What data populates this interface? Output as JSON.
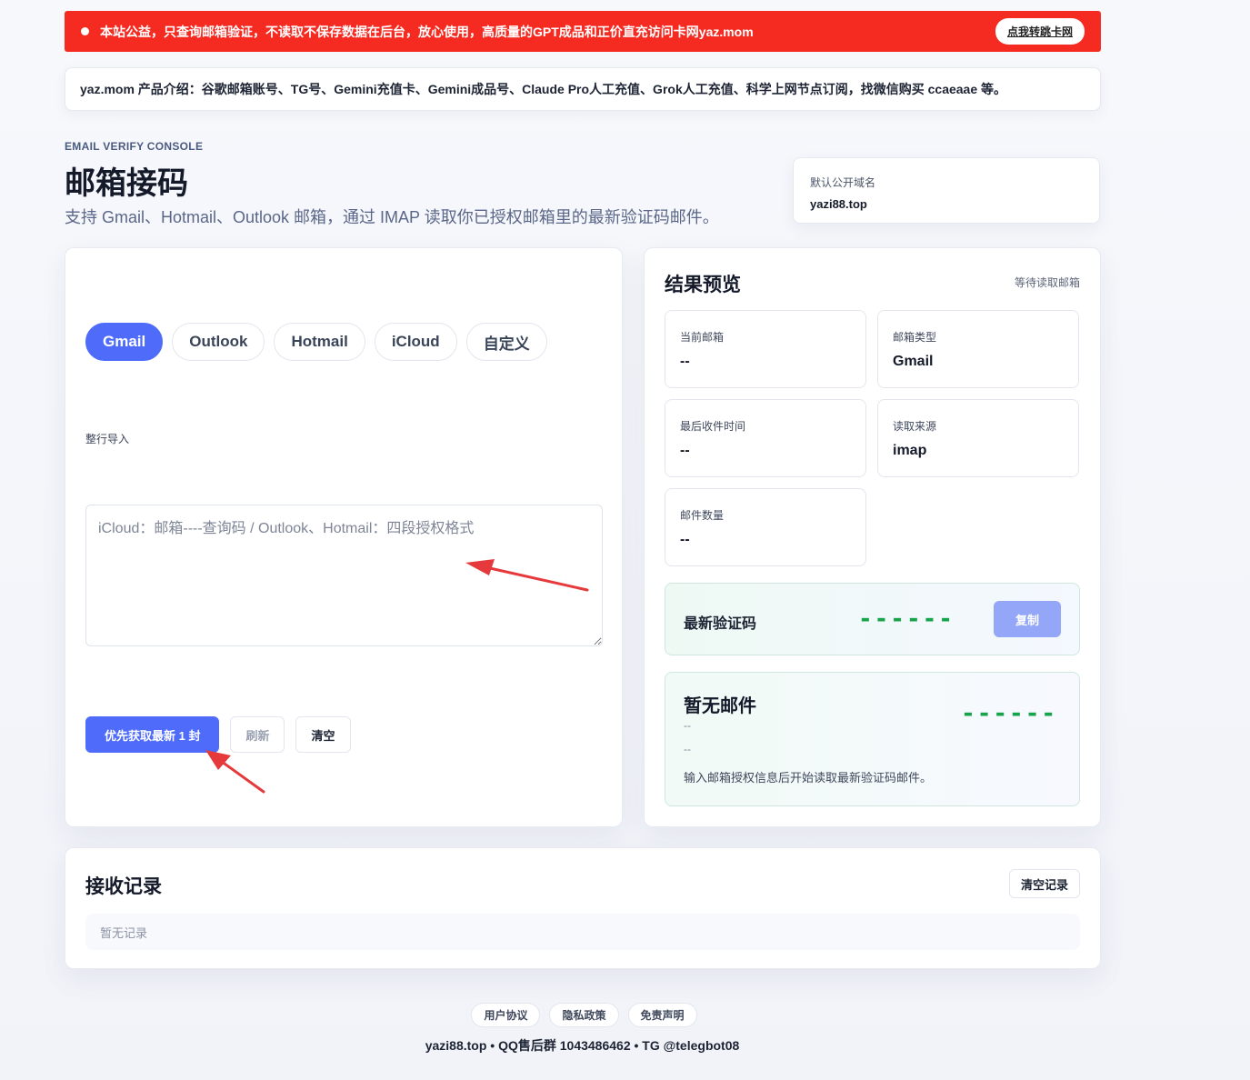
{
  "notice": {
    "text": "本站公益，只查询邮箱验证，不读取不保存数据在后台，放心使用，高质量的GPT成品和正价直充访问卡网yaz.mom",
    "jump_label": "点我转跳卡网"
  },
  "intro": {
    "text": "yaz.mom 产品介绍：谷歌邮箱账号、TG号、Gemini充值卡、Gemini成品号、Claude Pro人工充值、Grok人工充值、科学上网节点订阅，找微信购买 ccaeaae 等。"
  },
  "hero": {
    "eyebrow": "EMAIL VERIFY CONSOLE",
    "title": "邮箱接码",
    "subtitle": "支持 Gmail、Hotmail、Outlook 邮箱，通过 IMAP 读取你已授权邮箱里的最新验证码邮件。"
  },
  "domain": {
    "label": "默认公开域名",
    "value": "yazi88.top"
  },
  "tabs": [
    "Gmail",
    "Outlook",
    "Hotmail",
    "iCloud",
    "自定义"
  ],
  "form": {
    "import_label": "整行导入",
    "placeholder": "iCloud：邮箱----查询码 / Outlook、Hotmail：四段授权格式",
    "fetch_label": "优先获取最新 1 封",
    "refresh_label": "刷新",
    "clear_label": "清空"
  },
  "preview": {
    "title": "结果预览",
    "status": "等待读取邮箱",
    "stats": [
      {
        "label": "当前邮箱",
        "value": "--"
      },
      {
        "label": "邮箱类型",
        "value": "Gmail"
      },
      {
        "label": "最后收件时间",
        "value": "--"
      },
      {
        "label": "读取来源",
        "value": "imap"
      },
      {
        "label": "邮件数量",
        "value": "--"
      }
    ],
    "code_label": "最新验证码",
    "code_value": "------",
    "copy_label": "复制",
    "mail_title": "暂无邮件",
    "mail_from": "--",
    "mail_time": "--",
    "mail_code": "------",
    "mail_message": "输入邮箱授权信息后开始读取最新验证码邮件。"
  },
  "records": {
    "title": "接收记录",
    "clear_label": "清空记录",
    "empty_text": "暂无记录"
  },
  "footer": {
    "links": [
      "用户协议",
      "隐私政策",
      "免责声明"
    ],
    "line": "yazi88.top • QQ售后群 1043486462 • TG @telegbot08"
  },
  "colors": {
    "notice_red": "#f52b22",
    "accent": "#4e6bfa",
    "code_green": "#17a34a"
  }
}
